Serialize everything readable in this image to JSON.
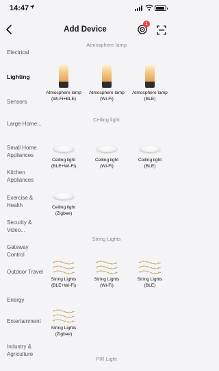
{
  "status_bar": {
    "time": "14:47",
    "location_icon": "location-arrow-icon",
    "signal_icon": "cellular-signal-icon",
    "wifi_icon": "wifi-icon",
    "battery_icon": "battery-icon"
  },
  "navbar": {
    "title": "Add Device",
    "back_icon": "chevron-left-icon",
    "notification_icon": "target-bell-icon",
    "notification_badge": "1",
    "scan_icon": "scan-icon"
  },
  "colors": {
    "background": "#f4f4f6",
    "badge": "#ee4343",
    "active_text": "#111111",
    "inactive_text": "#555555",
    "section_title": "#8a8a8e"
  },
  "sidebar": {
    "items": [
      {
        "label": "Electrical",
        "active": false
      },
      {
        "label": "Lighting",
        "active": true
      },
      {
        "label": "Sensors",
        "active": false
      },
      {
        "label": "Large Home...",
        "active": false
      },
      {
        "label": "Small Home Appliances",
        "active": false
      },
      {
        "label": "Kitchen Appliances",
        "active": false
      },
      {
        "label": "Exercise & Health",
        "active": false
      },
      {
        "label": "Security & Video...",
        "active": false
      },
      {
        "label": "Gateway Control",
        "active": false
      },
      {
        "label": "Outdoor Travel",
        "active": false
      },
      {
        "label": "Energy",
        "active": false
      },
      {
        "label": "Entertainment",
        "active": false
      },
      {
        "label": "Industry & Agriculture",
        "active": false
      }
    ]
  },
  "sections": [
    {
      "title": "Atmosphere lamp",
      "icon": "atmosphere-lamp-icon",
      "items": [
        {
          "line1": "Atmosphere lamp",
          "line2": "(Wi-Fi+BLE)"
        },
        {
          "line1": "Atmosphere lamp",
          "line2": "(Wi-Fi)"
        },
        {
          "line1": "Atmosphere lamp",
          "line2": "(BLE)"
        }
      ]
    },
    {
      "title": "Ceiling light",
      "icon": "ceiling-light-icon",
      "items": [
        {
          "line1": "Ceiling light",
          "line2": "(BLE+Wi-Fi)"
        },
        {
          "line1": "Ceiling light",
          "line2": "(Wi-Fi)"
        },
        {
          "line1": "Ceiling light",
          "line2": "(BLE)"
        },
        {
          "line1": "Ceiling light",
          "line2": "(Zigbee)"
        }
      ]
    },
    {
      "title": "String Lights",
      "icon": "string-lights-icon",
      "items": [
        {
          "line1": "String Lights",
          "line2": "(BLE+Wi-Fi)"
        },
        {
          "line1": "String Lights",
          "line2": "(Wi-Fi)"
        },
        {
          "line1": "String Lights",
          "line2": "(BLE)"
        },
        {
          "line1": "String Lights",
          "line2": "(Zigbee)"
        }
      ]
    },
    {
      "title": "PIR Light",
      "items": []
    }
  ]
}
